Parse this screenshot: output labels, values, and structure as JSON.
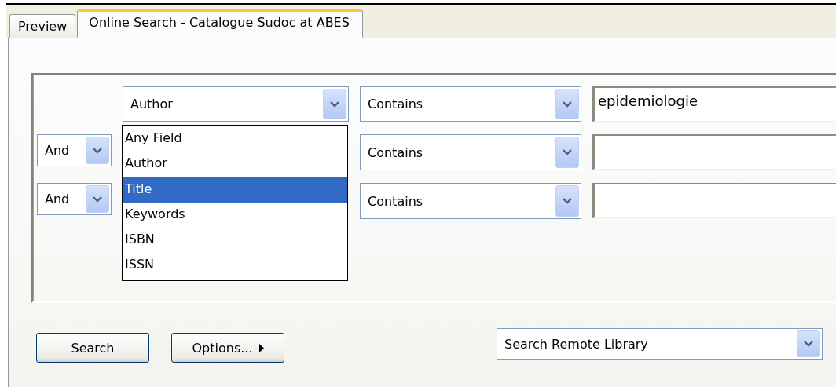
{
  "tabs": [
    {
      "label": "Preview",
      "selected": false
    },
    {
      "label": "Online Search - Catalogue Sudoc at ABES",
      "selected": true
    }
  ],
  "criteria": [
    {
      "field": "Author",
      "operator": "Contains",
      "value": "epidemiologie"
    },
    {
      "connector": "And",
      "operator": "Contains"
    },
    {
      "connector": "And",
      "operator": "Contains"
    }
  ],
  "field_dropdown": {
    "options": [
      {
        "label": "Any Field",
        "selected": false
      },
      {
        "label": "Author",
        "selected": false
      },
      {
        "label": "Title",
        "selected": true
      },
      {
        "label": "Keywords",
        "selected": false
      },
      {
        "label": "ISBN",
        "selected": false
      },
      {
        "label": "ISSN",
        "selected": false
      }
    ]
  },
  "buttons": [
    {
      "label": "Search",
      "kind": "plain"
    },
    {
      "label": "Options...",
      "kind": "menu"
    }
  ],
  "target": {
    "value": "Search Remote Library"
  }
}
